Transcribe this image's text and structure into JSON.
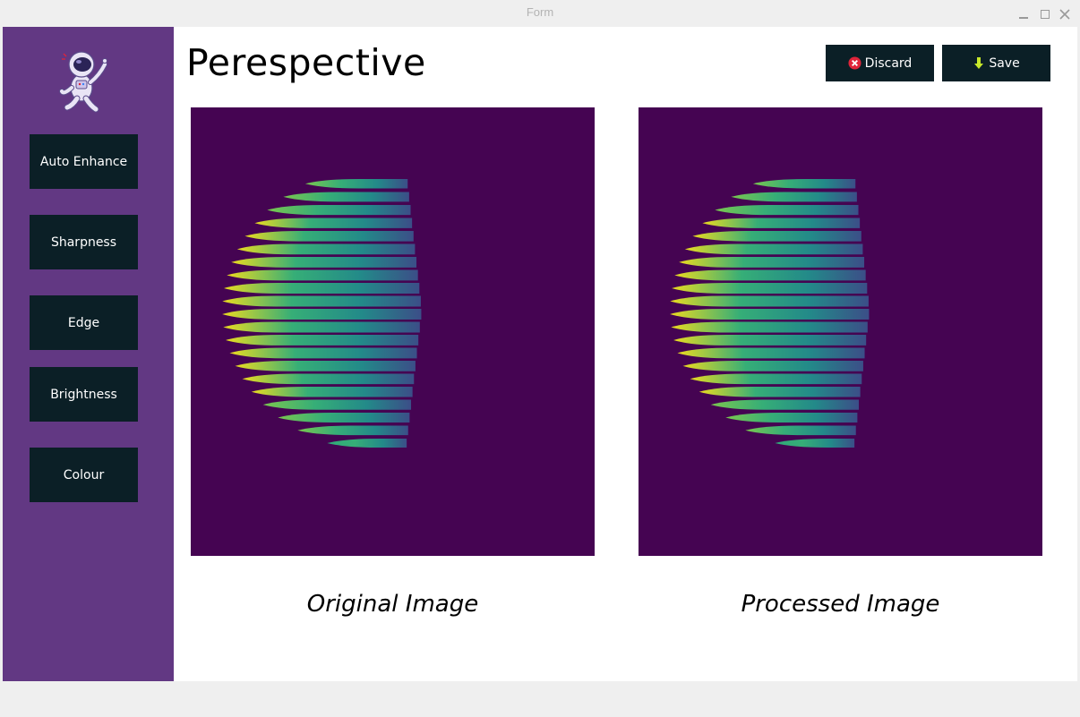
{
  "window": {
    "title": "Form"
  },
  "sidebar": {
    "logo": "astronaut-logo",
    "buttons": [
      {
        "label": "Auto Enhance"
      },
      {
        "label": "Sharpness"
      },
      {
        "label": "Edge"
      },
      {
        "label": "Brightness"
      },
      {
        "label": "Colour"
      }
    ]
  },
  "header": {
    "title": "Perespective",
    "discard_label": "Discard",
    "save_label": "Save",
    "discard_icon": "close-circle-icon",
    "save_icon": "download-arrow-icon"
  },
  "panels": {
    "original_caption": "Original Image",
    "processed_caption": "Processed Image"
  },
  "colors": {
    "sidebar_bg": "#623883",
    "button_bg": "#0b1f26",
    "image_bg": "#450452",
    "discard_icon": "#e0243a",
    "save_icon": "#c7e82a"
  }
}
